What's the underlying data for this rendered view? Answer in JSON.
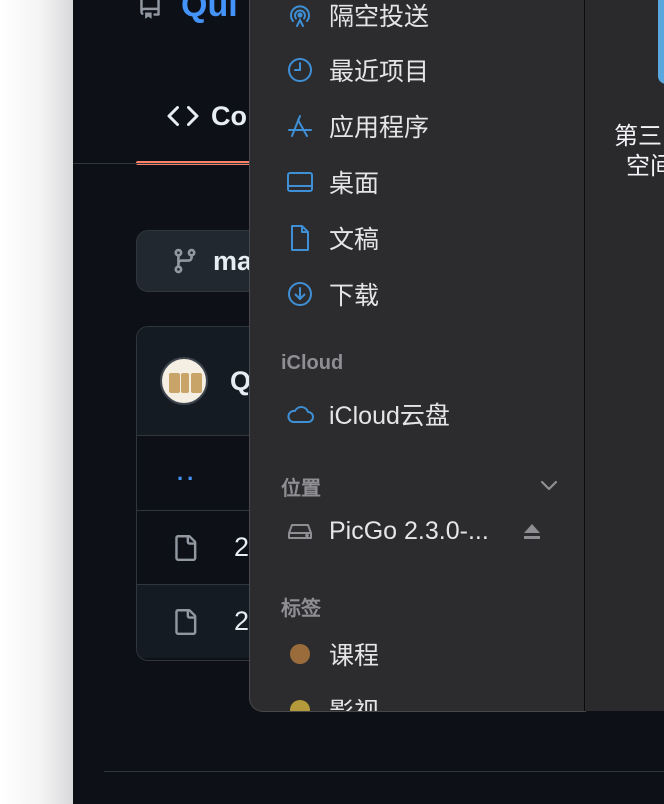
{
  "github": {
    "repo_name": "Qui",
    "code_tab_label": "Co",
    "branch_label": "ma",
    "commit_author": "Q",
    "parent_dir": "..",
    "files": [
      {
        "name": "2"
      },
      {
        "name": "2"
      }
    ],
    "accent_color": "#4493f8",
    "tab_underline_color": "#f78166"
  },
  "finder_sidebar": {
    "items": [
      {
        "label": "隔空投送",
        "icon": "airdrop-icon"
      },
      {
        "label": "最近项目",
        "icon": "clock-icon"
      },
      {
        "label": "应用程序",
        "icon": "applications-icon"
      },
      {
        "label": "桌面",
        "icon": "desktop-icon"
      },
      {
        "label": "文稿",
        "icon": "document-icon"
      },
      {
        "label": "下载",
        "icon": "download-icon"
      }
    ],
    "icloud_section": "iCloud",
    "icloud_drive": "iCloud云盘",
    "locations_section": "位置",
    "locations": [
      {
        "label": "PicGo 2.3.0-...",
        "icon": "disk-icon"
      }
    ],
    "tags_section": "标签",
    "tags": [
      {
        "label": "课程",
        "color": "#9a6c3b"
      },
      {
        "label": "影视",
        "color": "#b49a3a"
      }
    ],
    "icon_color": "#3f8fd6"
  },
  "finder_content": {
    "item_caption_line1": "第三",
    "item_caption_line2": "空间"
  }
}
